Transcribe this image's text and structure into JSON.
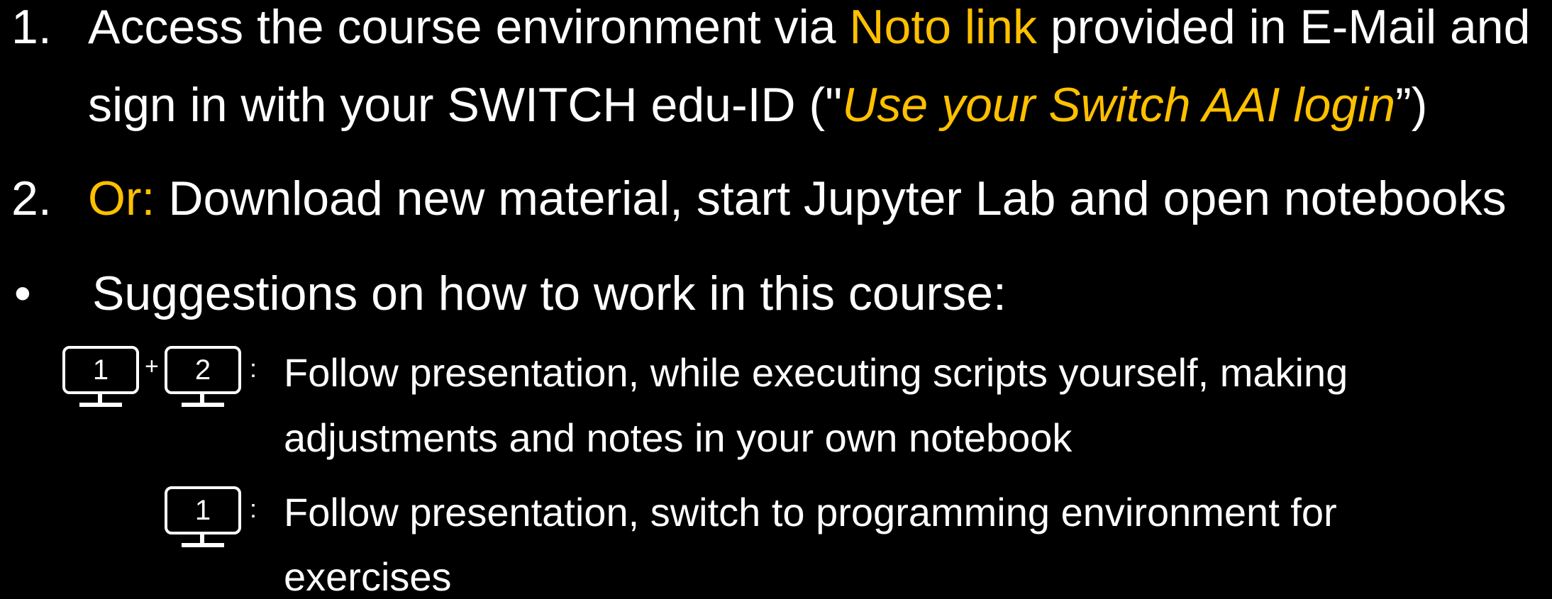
{
  "item1": {
    "number": "1.",
    "line1_pre": "Access the course environment via ",
    "line1_link": "Noto link",
    "line1_post": " provided in E-Mail and",
    "line2_pre": "sign in with your SWITCH edu-ID (\"",
    "line2_italic": "Use your Switch AAI login",
    "line2_post": "”)"
  },
  "item2": {
    "number": "2.",
    "lead": "Or:",
    "text": " Download new material, start Jupyter Lab and open notebooks"
  },
  "bullet": {
    "symbol": "•",
    "text": "Suggestions on how to work in this course:"
  },
  "suggestion1": {
    "monitor_a": "1",
    "plus": "+",
    "monitor_b": "2",
    "colon": ":",
    "line1": "Follow presentation, while executing scripts yourself, making",
    "line2": "adjustments and notes in your own notebook"
  },
  "suggestion2": {
    "monitor": "1",
    "colon": ":",
    "line1": "Follow presentation, switch to programming environment for",
    "line2": "exercises"
  },
  "colors": {
    "background": "#000000",
    "text": "#ffffff",
    "highlight": "#ffc000"
  },
  "icons": [
    "monitor-icon"
  ]
}
